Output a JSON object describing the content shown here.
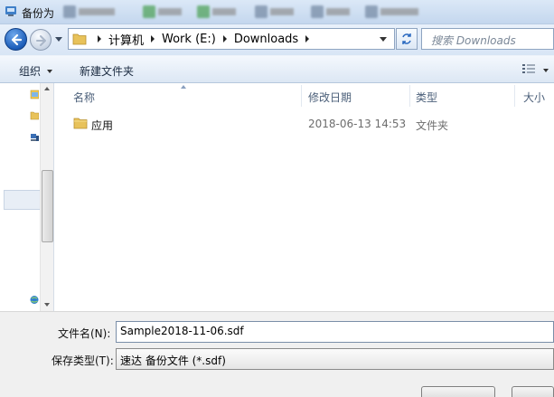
{
  "window": {
    "title": "备份为"
  },
  "address": {
    "crumbs": [
      "计算机",
      "Work (E:)",
      "Downloads"
    ]
  },
  "search": {
    "placeholder": "搜索 Downloads"
  },
  "commands": {
    "organize": "组织",
    "new_folder": "新建文件夹"
  },
  "columns": {
    "name": "名称",
    "modified": "修改日期",
    "type": "类型",
    "size": "大小"
  },
  "files": [
    {
      "name": "应用",
      "modified": "2018-06-13 14:53",
      "type": "文件夹"
    }
  ],
  "form": {
    "filename_label": "文件名(N):",
    "filename_value": "Sample2018-11-06.sdf",
    "filetype_label": "保存类型(T):",
    "filetype_value": "速达 备份文件 (*.sdf)"
  },
  "colors": {
    "accent": "#1c5db9",
    "folder": "#e8c25a"
  },
  "icons": [
    "back-arrow-icon",
    "forward-arrow-icon",
    "folder-icon",
    "refresh-icon",
    "search-icon",
    "view-options-icon"
  ]
}
